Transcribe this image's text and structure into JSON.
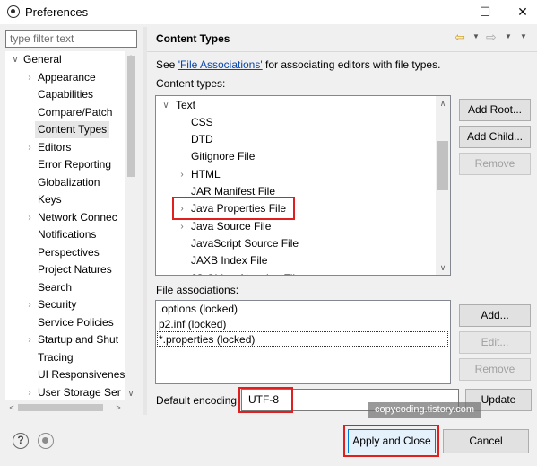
{
  "window": {
    "title": "Preferences",
    "minimize": "—",
    "maximize": "☐",
    "close": "✕"
  },
  "filter": {
    "placeholder": "type filter text"
  },
  "tree": [
    {
      "label": "General",
      "arrow": "∨"
    },
    {
      "label": "Appearance",
      "arrow": "›"
    },
    {
      "label": "Capabilities",
      "arrow": ""
    },
    {
      "label": "Compare/Patch",
      "arrow": ""
    },
    {
      "label": "Content Types",
      "arrow": ""
    },
    {
      "label": "Editors",
      "arrow": "›"
    },
    {
      "label": "Error Reporting",
      "arrow": ""
    },
    {
      "label": "Globalization",
      "arrow": ""
    },
    {
      "label": "Keys",
      "arrow": ""
    },
    {
      "label": "Network Connec",
      "arrow": "›"
    },
    {
      "label": "Notifications",
      "arrow": ""
    },
    {
      "label": "Perspectives",
      "arrow": ""
    },
    {
      "label": "Project Natures",
      "arrow": ""
    },
    {
      "label": "Search",
      "arrow": ""
    },
    {
      "label": "Security",
      "arrow": "›"
    },
    {
      "label": "Service Policies",
      "arrow": ""
    },
    {
      "label": "Startup and Shut",
      "arrow": "›"
    },
    {
      "label": "Tracing",
      "arrow": ""
    },
    {
      "label": "UI Responsivenes",
      "arrow": ""
    },
    {
      "label": "User Storage Ser",
      "arrow": "›"
    }
  ],
  "scroll_arrows": {
    "up": "∧",
    "down": "∨",
    "left": "<",
    "right": ">"
  },
  "page": {
    "title": "Content Types",
    "see_prefix": "See ",
    "see_link": "'File Associations'",
    "see_suffix": " for associating editors with file types.",
    "content_types_label": "Content types:",
    "file_assoc_label": "File associations:",
    "encoding_label": "Default encoding:",
    "encoding_value": "UTF-8"
  },
  "nav": {
    "back": "⇦",
    "forward": "⇨",
    "dropdown": "▼"
  },
  "content_types": [
    {
      "label": "Text",
      "arrow": "∨"
    },
    {
      "label": "CSS",
      "arrow": ""
    },
    {
      "label": "DTD",
      "arrow": ""
    },
    {
      "label": "Gitignore File",
      "arrow": ""
    },
    {
      "label": "HTML",
      "arrow": "›"
    },
    {
      "label": "JAR Manifest File",
      "arrow": ""
    },
    {
      "label": "Java Properties File",
      "arrow": "›"
    },
    {
      "label": "Java Source File",
      "arrow": "›"
    },
    {
      "label": "JavaScript Source File",
      "arrow": ""
    },
    {
      "label": "JAXB Index File",
      "arrow": ""
    },
    {
      "label": "JS Object Notation File",
      "arrow": ""
    }
  ],
  "file_associations": [
    ".options (locked)",
    "p2.inf (locked)",
    "*.properties (locked)"
  ],
  "buttons": {
    "add_root": "Add Root...",
    "add_child": "Add Child...",
    "remove_ct": "Remove",
    "add": "Add...",
    "edit": "Edit...",
    "remove_fa": "Remove",
    "update": "Update",
    "apply_close": "Apply and Close",
    "cancel": "Cancel"
  },
  "help": "?",
  "watermark": "copycoding.tistory.com"
}
